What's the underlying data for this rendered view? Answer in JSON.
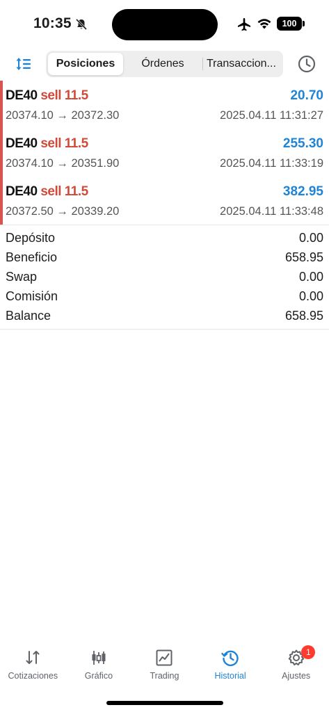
{
  "status": {
    "time": "10:35",
    "battery": "100",
    "icons": [
      "bell-off-icon",
      "airplane-icon",
      "wifi-icon",
      "battery-icon"
    ]
  },
  "toolbar": {
    "sort_icon": "sort-icon",
    "history_icon": "clock-icon",
    "segments": [
      {
        "label": "Posiciones",
        "selected": true
      },
      {
        "label": "Órdenes",
        "selected": false
      },
      {
        "label": "Transaccion...",
        "selected": false
      }
    ]
  },
  "positions": [
    {
      "symbol": "DE40",
      "side": "sell 11.5",
      "profit": "20.70",
      "prices": "20374.10 → 20372.30",
      "datetime": "2025.04.11 11:31:27"
    },
    {
      "symbol": "DE40",
      "side": "sell 11.5",
      "profit": "255.30",
      "prices": "20374.10 → 20351.90",
      "datetime": "2025.04.11 11:33:19"
    },
    {
      "symbol": "DE40",
      "side": "sell 11.5",
      "profit": "382.95",
      "prices": "20372.50 → 20339.20",
      "datetime": "2025.04.11 11:33:48"
    }
  ],
  "summary": [
    {
      "label": "Depósito",
      "value": "0.00"
    },
    {
      "label": "Beneficio",
      "value": "658.95"
    },
    {
      "label": "Swap",
      "value": "0.00"
    },
    {
      "label": "Comisión",
      "value": "0.00"
    },
    {
      "label": "Balance",
      "value": "658.95"
    }
  ],
  "tabbar": {
    "tabs": [
      {
        "label": "Cotizaciones",
        "icon": "quotes-icon",
        "active": false
      },
      {
        "label": "Gráfico",
        "icon": "chart-icon",
        "active": false
      },
      {
        "label": "Trading",
        "icon": "trading-icon",
        "active": false
      },
      {
        "label": "Historial",
        "icon": "history-icon",
        "active": true
      },
      {
        "label": "Ajustes",
        "icon": "settings-icon",
        "active": false,
        "badge": "1"
      }
    ]
  },
  "colors": {
    "accent": "#1f83d6",
    "sell": "#d04a3a",
    "position_bar": "#d9534f",
    "badge": "#ff3b30"
  }
}
